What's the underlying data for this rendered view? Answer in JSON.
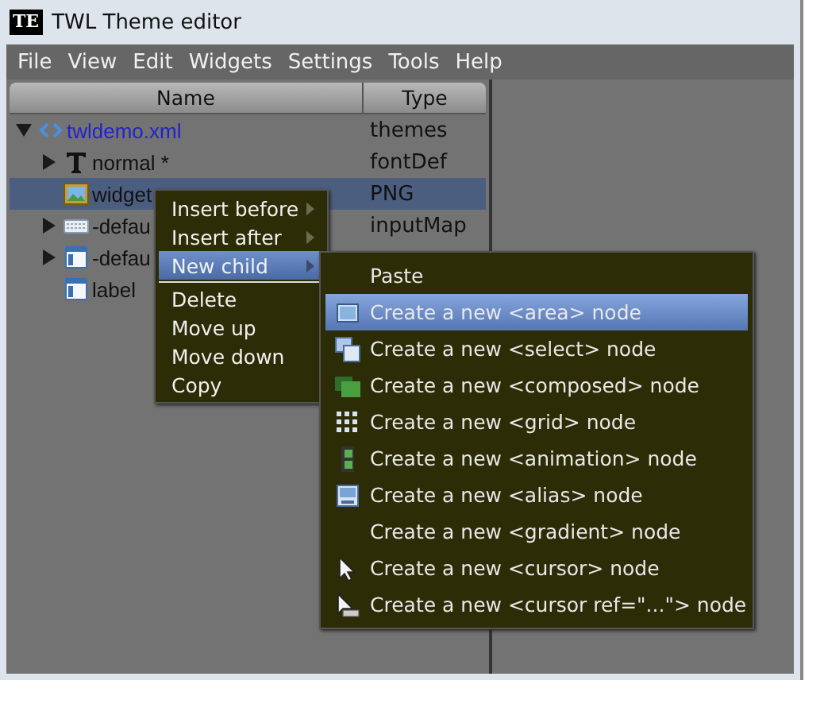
{
  "window": {
    "app_icon": "TE",
    "title": "TWL Theme editor"
  },
  "menu_bar": [
    "File",
    "View",
    "Edit",
    "Widgets",
    "Settings",
    "Tools",
    "Help"
  ],
  "tree": {
    "columns": [
      "Name",
      "Type"
    ],
    "rows": [
      {
        "name": "twldemo.xml",
        "type": "themes",
        "kind": "file",
        "expanded": true,
        "selected": false,
        "children": [
          {
            "name": "normal *",
            "type": "fontDef",
            "kind": "font",
            "expanded": false,
            "selected": false
          },
          {
            "name": "widget",
            "type": "PNG",
            "kind": "image",
            "selected": true
          },
          {
            "name": "-defau",
            "type": "inputMap",
            "kind": "keyboard",
            "expanded": false,
            "selected": false
          },
          {
            "name": "-defau",
            "kind": "window",
            "expanded": false,
            "selected": false
          },
          {
            "name": "label",
            "kind": "window",
            "selected": false
          }
        ]
      }
    ]
  },
  "context_menu": [
    {
      "label": "Insert before",
      "submenu": true,
      "selected": false
    },
    {
      "label": "Insert after",
      "submenu": true,
      "selected": false
    },
    {
      "label": "New child",
      "submenu": true,
      "selected": true
    },
    {
      "label": "Delete",
      "submenu": false,
      "selected": false
    },
    {
      "label": "Move up",
      "submenu": false,
      "selected": false
    },
    {
      "label": "Move down",
      "submenu": false,
      "selected": false
    },
    {
      "label": "Copy",
      "submenu": false,
      "selected": false
    }
  ],
  "submenu": [
    {
      "label": "Paste",
      "kind": "plain",
      "selected": false
    },
    {
      "label": "Create a new <area> node",
      "kind": "area",
      "selected": true
    },
    {
      "label": "Create a new <select> node",
      "kind": "select",
      "selected": false
    },
    {
      "label": "Create a new <composed> node",
      "kind": "composed",
      "selected": false
    },
    {
      "label": "Create a new <grid> node",
      "kind": "grid",
      "selected": false
    },
    {
      "label": "Create a new <animation> node",
      "kind": "animation",
      "selected": false
    },
    {
      "label": "Create a new <alias> node",
      "kind": "alias",
      "selected": false
    },
    {
      "label": "Create a new <gradient> node",
      "kind": "plain",
      "selected": false
    },
    {
      "label": "Create a new <cursor> node",
      "kind": "cursor",
      "selected": false
    },
    {
      "label": "Create a new <cursor ref=\"...\"> node",
      "kind": "cursorref",
      "selected": false
    }
  ]
}
